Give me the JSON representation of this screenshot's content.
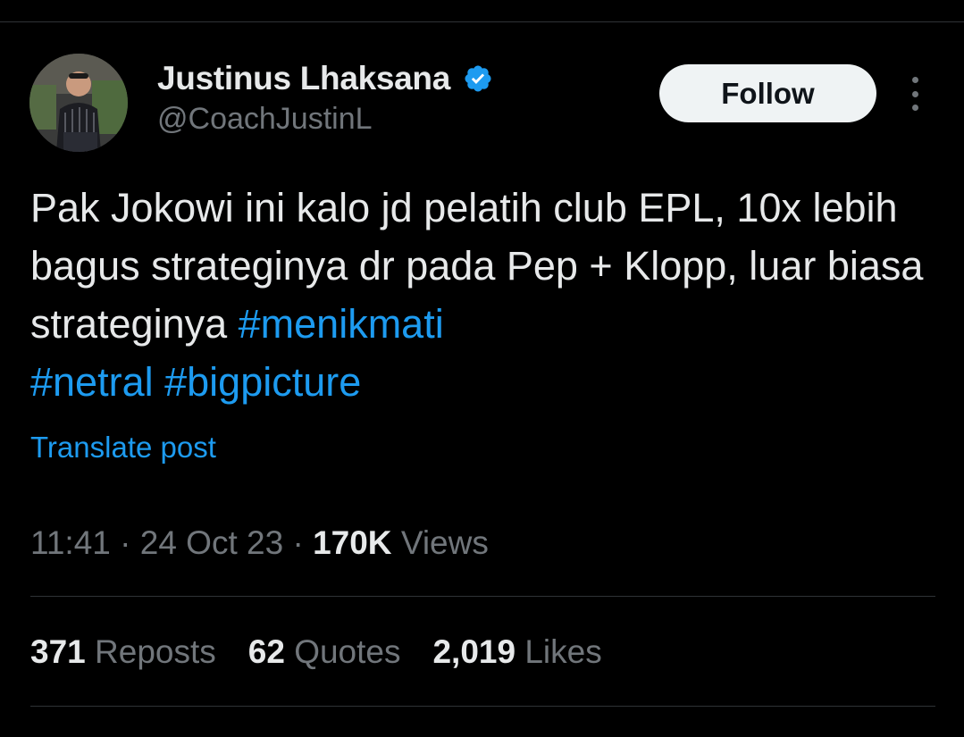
{
  "author": {
    "display_name": "Justinus Lhaksana",
    "handle": "@CoachJustinL",
    "verified": true,
    "avatar": "profile-photo"
  },
  "actions": {
    "follow_label": "Follow",
    "more_icon": "more-vertical-icon"
  },
  "tweet": {
    "text_plain": "Pak Jokowi ini kalo jd pelatih club EPL, 10x lebih bagus strateginya dr pada Pep + Klopp, luar biasa strateginya ",
    "hashtags": [
      "#menikmati",
      "#netral",
      "#bigpicture"
    ],
    "translate_label": "Translate post"
  },
  "meta": {
    "time": "11:41",
    "date": "24 Oct 23",
    "views_count": "170K",
    "views_label": "Views",
    "separator": "·"
  },
  "stats": {
    "reposts_count": "371",
    "reposts_label": "Reposts",
    "quotes_count": "62",
    "quotes_label": "Quotes",
    "likes_count": "2,019",
    "likes_label": "Likes"
  },
  "colors": {
    "background": "#000000",
    "text": "#e7e9ea",
    "secondary": "#71767b",
    "accent": "#1d9bf0",
    "divider": "#2f3336",
    "button_bg": "#eff3f4"
  }
}
